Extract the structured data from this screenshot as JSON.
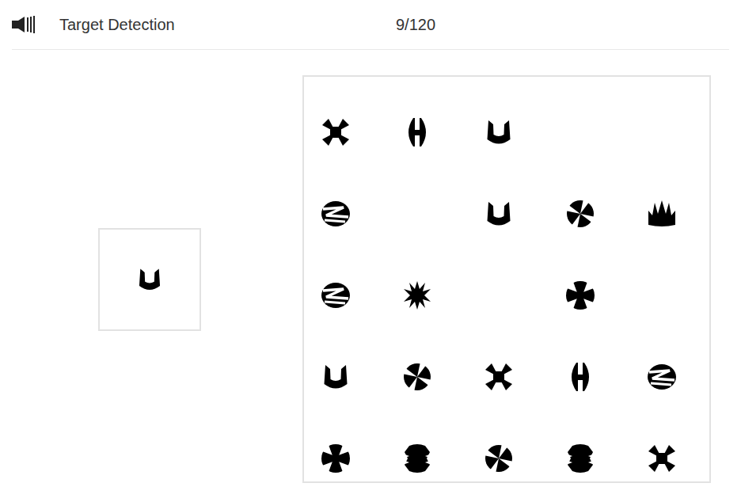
{
  "header": {
    "title": "Target Detection",
    "counter": "9/120"
  },
  "target": {
    "kind": "u-shape"
  },
  "grid": {
    "rows": [
      [
        {
          "kind": "x-shape"
        },
        {
          "kind": "h-shape"
        },
        {
          "kind": "u-shape"
        },
        {
          "kind": "empty"
        },
        {
          "kind": "empty"
        }
      ],
      [
        {
          "kind": "zigzag"
        },
        {
          "kind": "empty"
        },
        {
          "kind": "u-shape"
        },
        {
          "kind": "pinwheel"
        },
        {
          "kind": "crown"
        }
      ],
      [
        {
          "kind": "zigzag"
        },
        {
          "kind": "starburst"
        },
        {
          "kind": "empty"
        },
        {
          "kind": "cross"
        },
        {
          "kind": "empty"
        }
      ],
      [
        {
          "kind": "u-shape"
        },
        {
          "kind": "pinwheel"
        },
        {
          "kind": "x-shape"
        },
        {
          "kind": "h-shape"
        },
        {
          "kind": "zigzag"
        }
      ],
      [
        {
          "kind": "cross"
        },
        {
          "kind": "bug"
        },
        {
          "kind": "pinwheel"
        },
        {
          "kind": "bug"
        },
        {
          "kind": "x-shape"
        }
      ]
    ]
  }
}
